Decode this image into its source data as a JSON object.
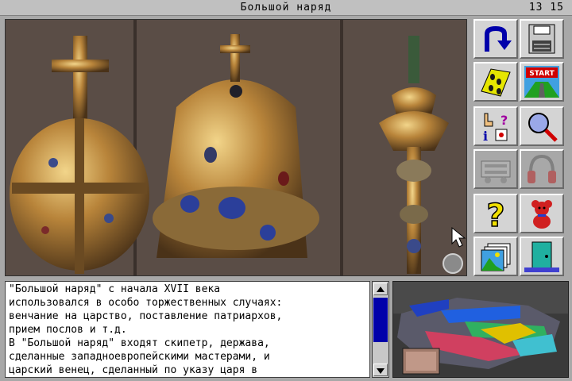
{
  "window": {
    "title": "Большой наряд",
    "clock": "13 15"
  },
  "description": {
    "lines": [
      "\"Большой наряд\" с начала XVII века",
      "использовался в особо торжественных случаях:",
      "венчание на царство, поставление патриархов,",
      "прием послов и т.д.",
      "В \"Большой наряд\" входят скипетр, держава,",
      "сделанные западноевропейскими мастерами, и",
      "царский венец, сделанный по указу царя в"
    ]
  },
  "toolbar": {
    "tools": [
      {
        "icon": "u-turn-back-icon"
      },
      {
        "icon": "floppy-disk-icon"
      },
      {
        "icon": "footprints-icon"
      },
      {
        "icon": "start-sign-icon"
      },
      {
        "icon": "pointer-info-icon"
      },
      {
        "icon": "magnifier-icon"
      },
      {
        "icon": "film-projector-icon"
      },
      {
        "icon": "headphones-icon"
      },
      {
        "icon": "question-mark-icon"
      },
      {
        "icon": "teddy-bear-icon"
      },
      {
        "icon": "photo-gallery-icon"
      },
      {
        "icon": "exit-door-icon"
      }
    ],
    "start_label": "START"
  },
  "colors": {
    "accent": "#0000aa",
    "frame": "#a8a8a8",
    "panel": "#d4d4d4"
  }
}
